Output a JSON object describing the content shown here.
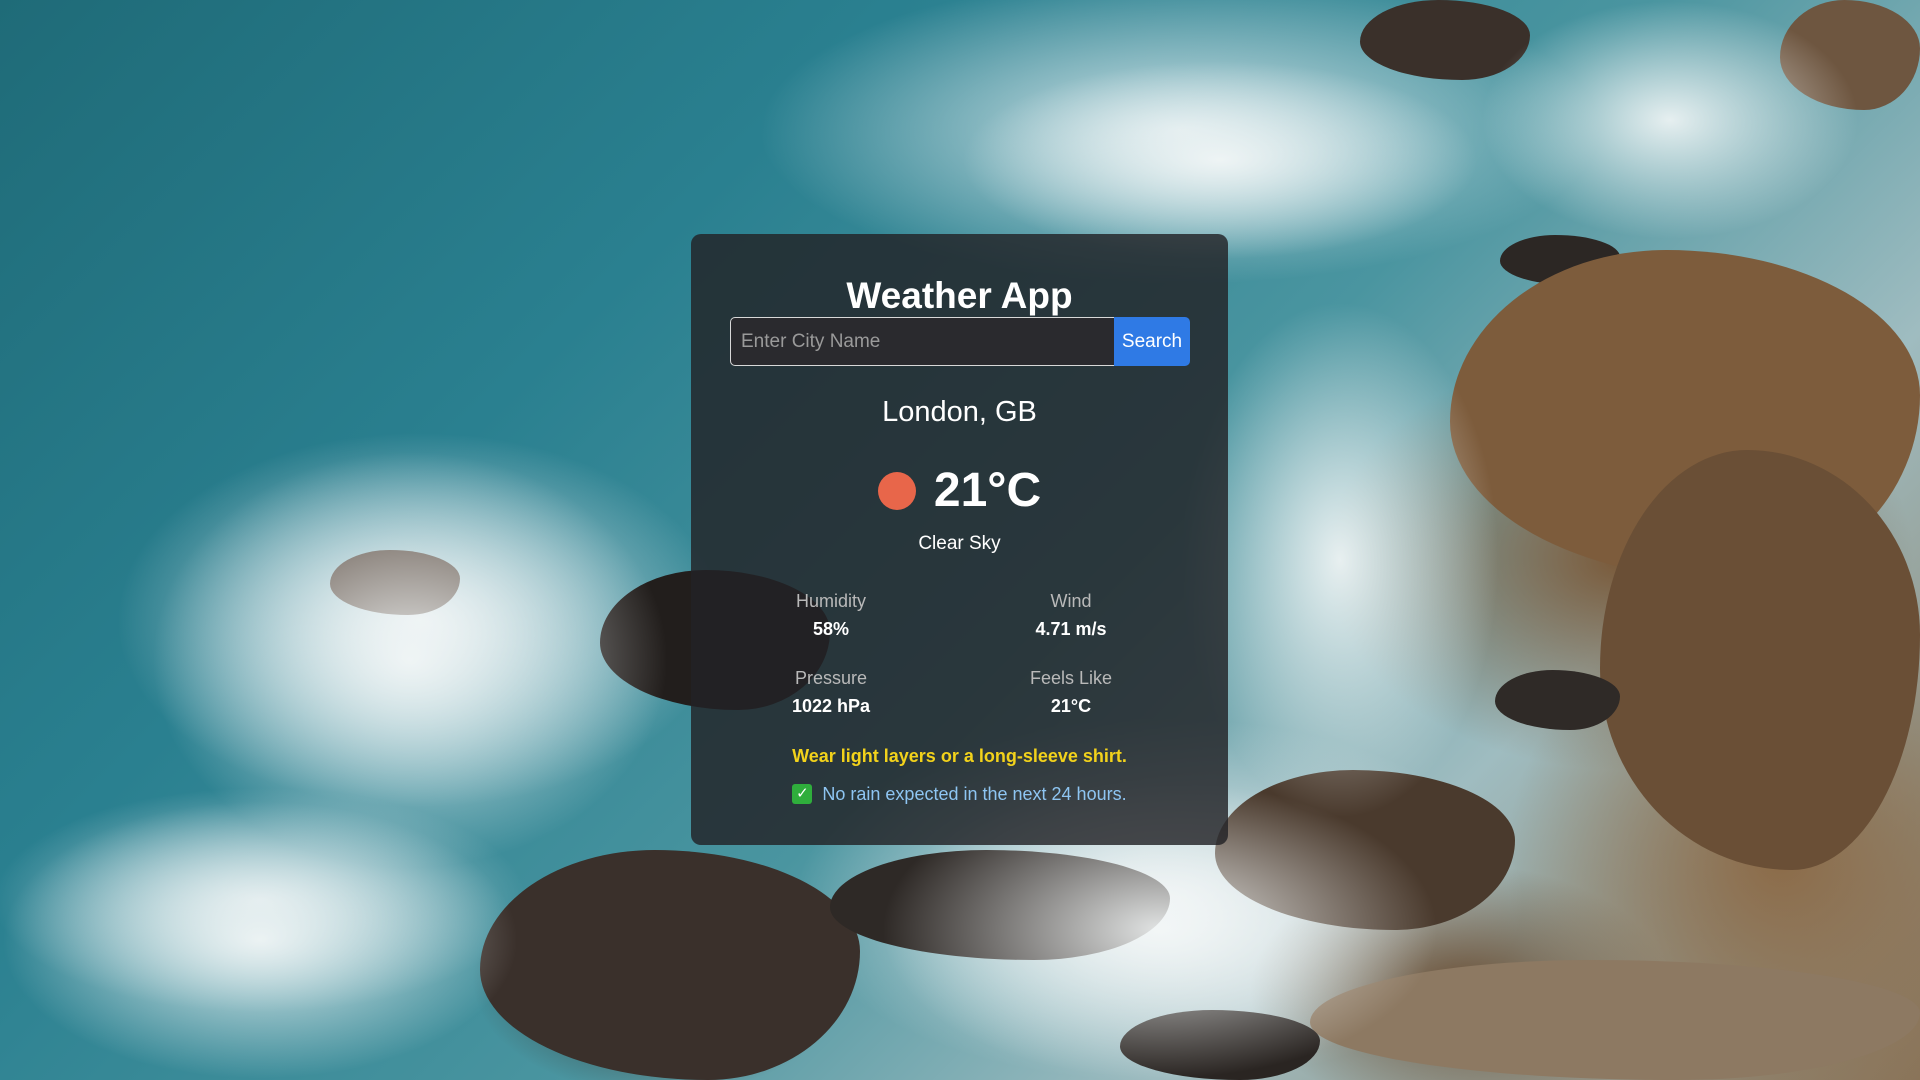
{
  "app": {
    "title": "Weather App"
  },
  "search": {
    "placeholder": "Enter City Name",
    "value": "",
    "button_label": "Search"
  },
  "weather": {
    "location": "London, GB",
    "icon": "sun-icon",
    "temperature": "21°C",
    "condition": "Clear Sky"
  },
  "stats": {
    "humidity": {
      "label": "Humidity",
      "value": "58%"
    },
    "wind": {
      "label": "Wind",
      "value": "4.71 m/s"
    },
    "pressure": {
      "label": "Pressure",
      "value": "1022 hPa"
    },
    "feels_like": {
      "label": "Feels Like",
      "value": "21°C"
    }
  },
  "advice": {
    "clothing": "Wear light layers or a long-sleeve shirt.",
    "rain_icon": "check-icon",
    "rain": "No rain expected in the next 24 hours."
  },
  "colors": {
    "sun": "#e8664a",
    "search_button": "#2f7ae5",
    "clothing_text": "#f2d21b",
    "rain_text": "#8ec5f2",
    "check_box": "#2fae3c"
  }
}
